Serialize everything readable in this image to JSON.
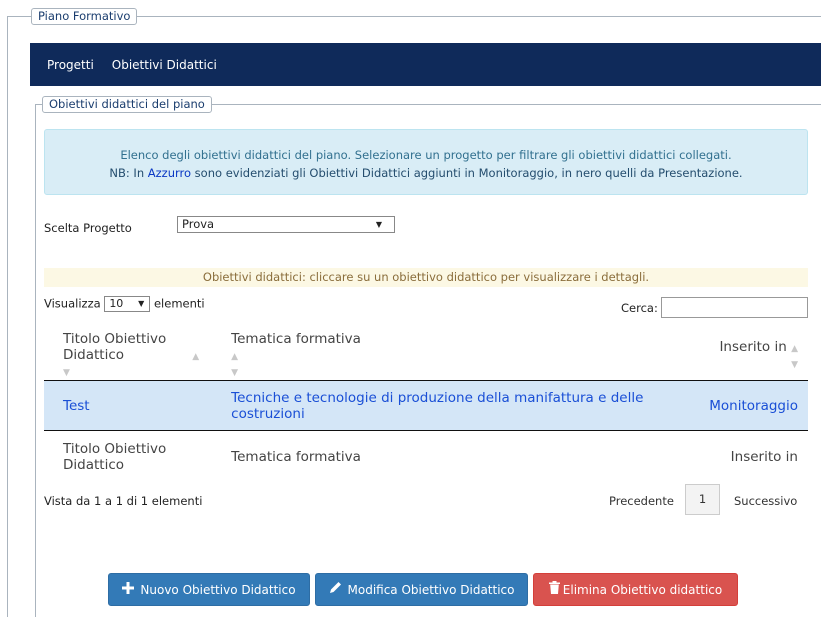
{
  "outer_legend": "Piano Formativo",
  "nav": {
    "items": [
      "Progetti",
      "Obiettivi Didattici"
    ]
  },
  "inner_legend": "Obiettivi didattici del piano",
  "info": {
    "line1": "Elenco degli obiettivi didattici del piano. Selezionare un progetto per filtrare gli obiettivi didattici collegati.",
    "line2_prefix": "NB: In ",
    "line2_highlight": "Azzurro",
    "line2_suffix": " sono evidenziati gli Obiettivi Didattici aggiunti in Monitoraggio, in nero quelli da Presentazione."
  },
  "scelta": {
    "label": "Scelta Progetto",
    "value": "Prova"
  },
  "warn": "Obiettivi didattici: cliccare su un obiettivo didattico per visualizzare i dettagli.",
  "length": {
    "prefix": "Visualizza",
    "value": "10",
    "suffix": "elementi"
  },
  "search": {
    "label": "Cerca:",
    "value": ""
  },
  "table": {
    "columns": [
      "Titolo Obiettivo Didattico",
      "Tematica formativa",
      "Inserito in"
    ],
    "rows": [
      {
        "titolo": "Test",
        "tematica": "Tecniche e tecnologie di produzione della manifattura e delle costruzioni",
        "inserito": "Monitoraggio"
      }
    ]
  },
  "footer_info": "Vista da 1 a 1 di 1 elementi",
  "pager": {
    "prev": "Precedente",
    "current": "1",
    "next": "Successivo"
  },
  "buttons": {
    "new": "Nuovo Obiettivo Didattico",
    "edit": "Modifica Obiettivo Didattico",
    "delete": "Elimina Obiettivo didattico"
  },
  "colors": {
    "nav_bg": "#0f2a5a",
    "primary": "#337ab7",
    "danger": "#d9534f",
    "row_highlight": "#d4e6f7",
    "monitoraggio_text": "#1a4fd6"
  }
}
